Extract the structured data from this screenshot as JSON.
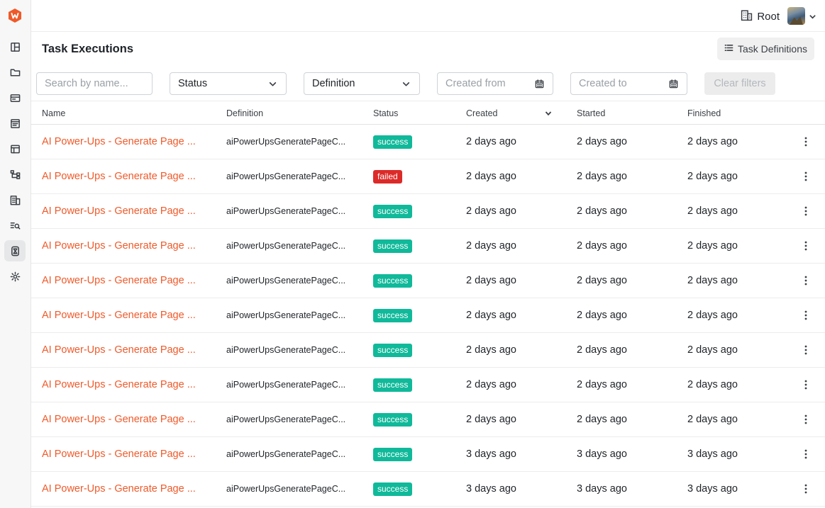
{
  "colors": {
    "accent": "#ef5a2a",
    "success": "#10b99a",
    "failed": "#dc2a28"
  },
  "sidebar": {
    "logo": "w-logo",
    "items": [
      {
        "icon": "layout-icon",
        "active": false
      },
      {
        "icon": "folder-icon",
        "active": false
      },
      {
        "icon": "media-icon",
        "active": false
      },
      {
        "icon": "document-icon",
        "active": false
      },
      {
        "icon": "table-icon",
        "active": false
      },
      {
        "icon": "sitemap-icon",
        "active": false
      },
      {
        "icon": "building-icon",
        "active": false
      },
      {
        "icon": "search-list-icon",
        "active": false
      },
      {
        "icon": "hourglass-icon",
        "active": true
      },
      {
        "icon": "gear-icon",
        "active": false
      }
    ]
  },
  "topbar": {
    "org_label": "Root"
  },
  "header": {
    "title": "Task Executions",
    "task_definitions_label": "Task Definitions"
  },
  "filters": {
    "search_placeholder": "Search by name...",
    "status_value": "Status",
    "definition_value": "Definition",
    "created_from_placeholder": "Created from",
    "created_to_placeholder": "Created to",
    "clear_label": "Clear filters"
  },
  "table": {
    "columns": [
      "Name",
      "Definition",
      "Status",
      "Created",
      "Started",
      "Finished"
    ],
    "rows": [
      {
        "name": "AI Power-Ups - Generate Page ...",
        "definition": "aiPowerUpsGeneratePageC...",
        "status": "success",
        "created": "2 days ago",
        "started": "2 days ago",
        "finished": "2 days ago"
      },
      {
        "name": "AI Power-Ups - Generate Page ...",
        "definition": "aiPowerUpsGeneratePageC...",
        "status": "failed",
        "created": "2 days ago",
        "started": "2 days ago",
        "finished": "2 days ago"
      },
      {
        "name": "AI Power-Ups - Generate Page ...",
        "definition": "aiPowerUpsGeneratePageC...",
        "status": "success",
        "created": "2 days ago",
        "started": "2 days ago",
        "finished": "2 days ago"
      },
      {
        "name": "AI Power-Ups - Generate Page ...",
        "definition": "aiPowerUpsGeneratePageC...",
        "status": "success",
        "created": "2 days ago",
        "started": "2 days ago",
        "finished": "2 days ago"
      },
      {
        "name": "AI Power-Ups - Generate Page ...",
        "definition": "aiPowerUpsGeneratePageC...",
        "status": "success",
        "created": "2 days ago",
        "started": "2 days ago",
        "finished": "2 days ago"
      },
      {
        "name": "AI Power-Ups - Generate Page ...",
        "definition": "aiPowerUpsGeneratePageC...",
        "status": "success",
        "created": "2 days ago",
        "started": "2 days ago",
        "finished": "2 days ago"
      },
      {
        "name": "AI Power-Ups - Generate Page ...",
        "definition": "aiPowerUpsGeneratePageC...",
        "status": "success",
        "created": "2 days ago",
        "started": "2 days ago",
        "finished": "2 days ago"
      },
      {
        "name": "AI Power-Ups - Generate Page ...",
        "definition": "aiPowerUpsGeneratePageC...",
        "status": "success",
        "created": "2 days ago",
        "started": "2 days ago",
        "finished": "2 days ago"
      },
      {
        "name": "AI Power-Ups - Generate Page ...",
        "definition": "aiPowerUpsGeneratePageC...",
        "status": "success",
        "created": "2 days ago",
        "started": "2 days ago",
        "finished": "2 days ago"
      },
      {
        "name": "AI Power-Ups - Generate Page ...",
        "definition": "aiPowerUpsGeneratePageC...",
        "status": "success",
        "created": "3 days ago",
        "started": "3 days ago",
        "finished": "3 days ago"
      },
      {
        "name": "AI Power-Ups - Generate Page ...",
        "definition": "aiPowerUpsGeneratePageC...",
        "status": "success",
        "created": "3 days ago",
        "started": "3 days ago",
        "finished": "3 days ago"
      }
    ]
  }
}
